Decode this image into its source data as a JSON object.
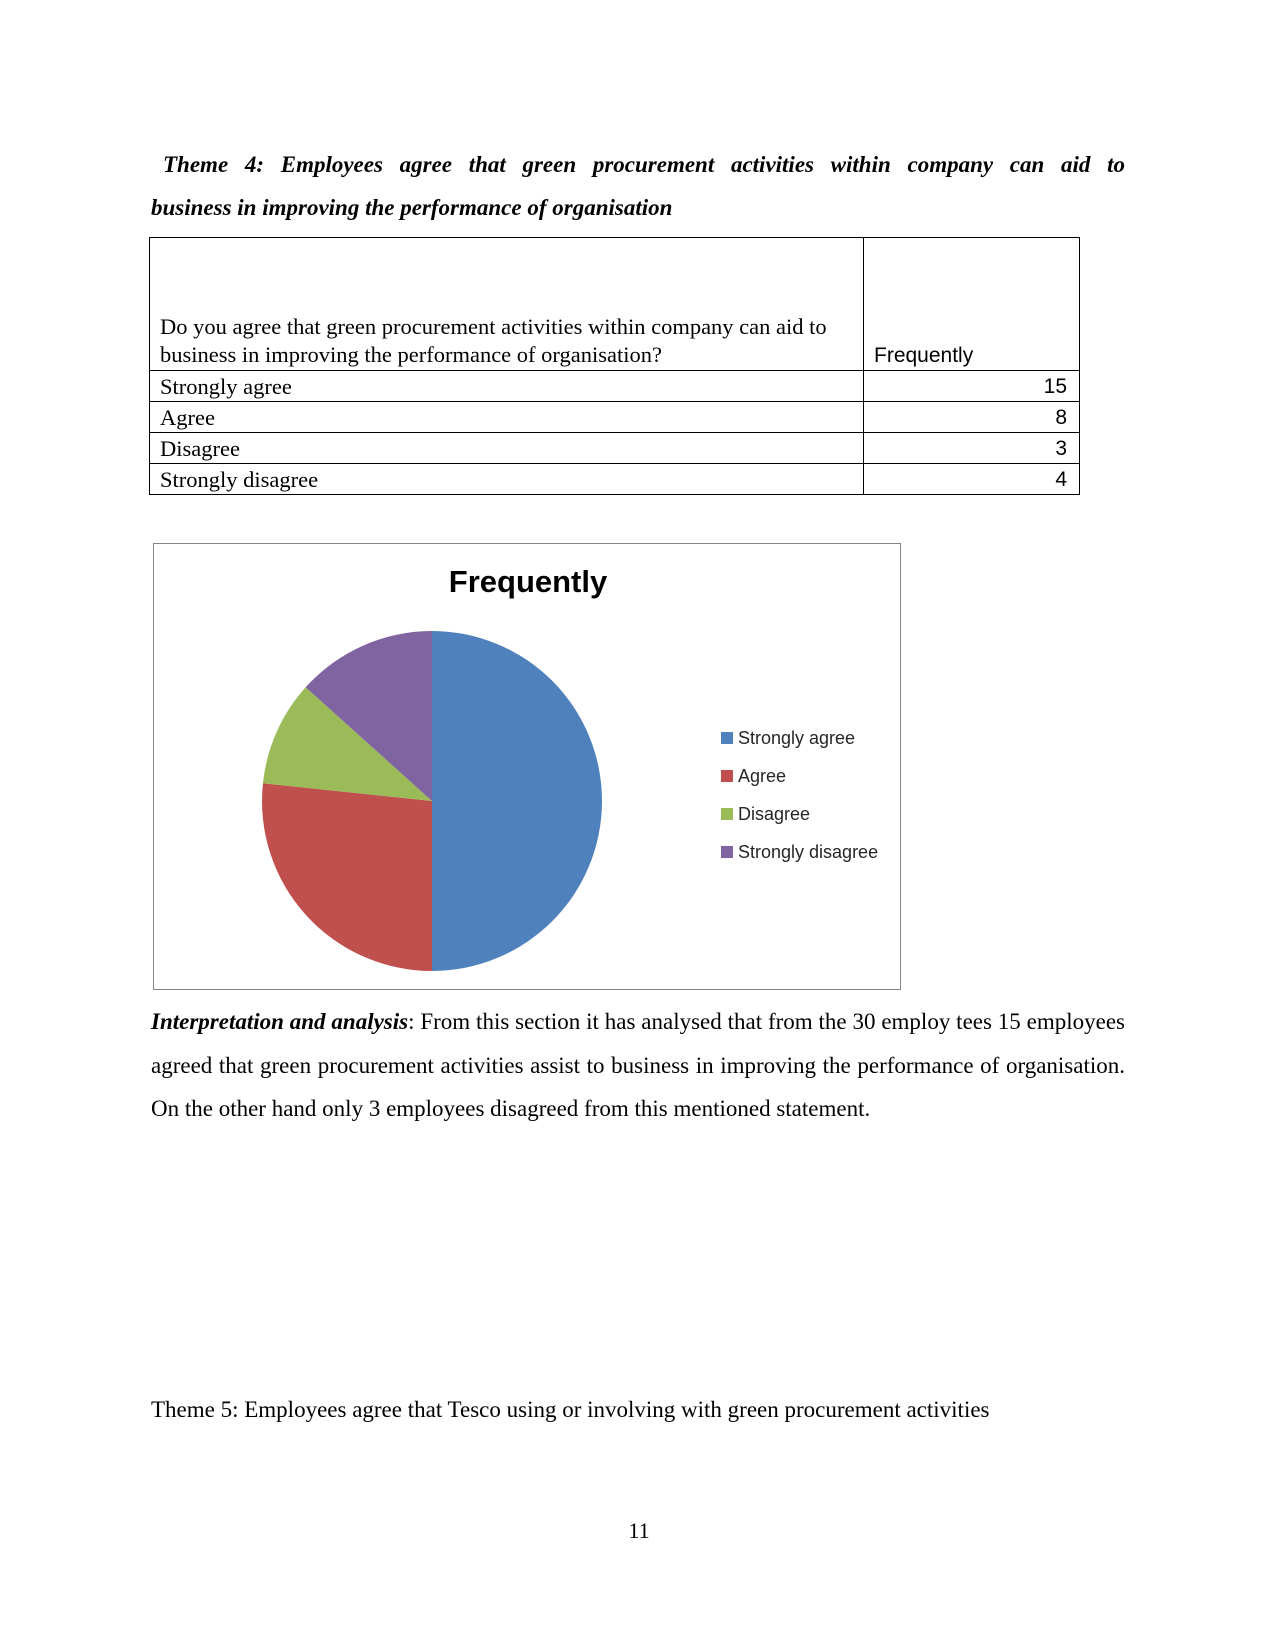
{
  "heading": {
    "line1": "Theme 4: Employees agree that green procurement activities within company can aid to",
    "line2": "business in improving the performance of organisation"
  },
  "table": {
    "question": "Do you  agree that green procurement activities within company can aid to business in improving the performance of organisation?",
    "column_header": "Frequently",
    "rows": [
      {
        "label": "Strongly agree",
        "value": "15"
      },
      {
        "label": "Agree",
        "value": "8"
      },
      {
        "label": "Disagree",
        "value": "3"
      },
      {
        "label": "Strongly disagree",
        "value": "4"
      }
    ]
  },
  "chart_data": {
    "type": "pie",
    "title": "Frequently",
    "categories": [
      "Strongly agree",
      "Agree",
      "Disagree",
      "Strongly disagree"
    ],
    "values": [
      15,
      8,
      3,
      4
    ],
    "colors": [
      "#4F81BD",
      "#C0504D",
      "#9BBB59",
      "#8064A2"
    ],
    "legend": "right",
    "start_angle_deg": 0,
    "direction": "clockwise"
  },
  "analysis": {
    "lead": "Interpretation and analysis",
    "body": ": From this section it has analysed that from the 30 employ tees 15 employees agreed that green procurement activities assist to business in improving the performance of organisation. On the other hand only 3 employees disagreed from this mentioned statement."
  },
  "theme5": "Theme 5: Employees agree that Tesco using or involving with green procurement activities",
  "page_number": "11"
}
